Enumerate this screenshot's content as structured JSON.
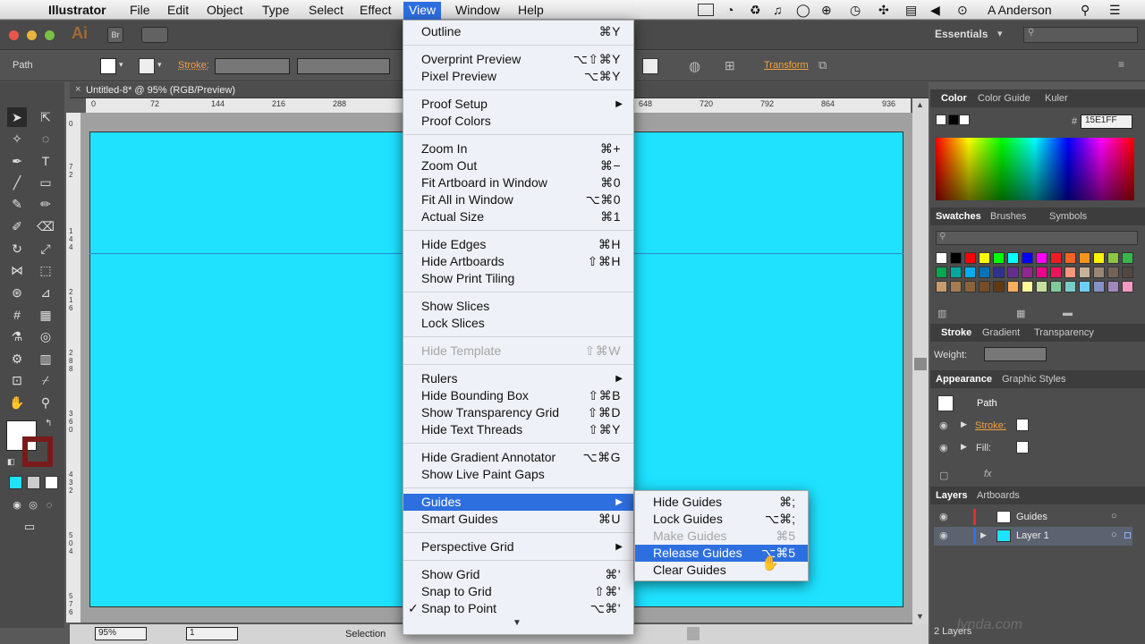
{
  "menubar": {
    "app": "Illustrator",
    "items": [
      "File",
      "Edit",
      "Object",
      "Type",
      "Select",
      "Effect",
      "View",
      "Window",
      "Help"
    ],
    "user": "A Anderson"
  },
  "approw": {
    "logo": "Ai",
    "bridge": "Br",
    "workspace": "Essentials"
  },
  "control": {
    "selection_label": "Path",
    "stroke_label": "Stroke:",
    "transform_label": "Transform"
  },
  "document": {
    "tab_title": "Untitled-8* @ 95% (RGB/Preview)",
    "zoom": "95%",
    "artboard_num": "1",
    "status": "Selection",
    "artboard_color": "#1EE2FF"
  },
  "ruler": {
    "h_ticks": [
      "0",
      "72",
      "144",
      "216",
      "288",
      "648",
      "720",
      "792",
      "864",
      "936"
    ],
    "v_ticks": [
      "0",
      "7\n2",
      "1\n4\n4",
      "2\n1\n6",
      "2\n8\n8",
      "3\n6\n0",
      "4\n3\n2",
      "5\n0\n4",
      "5\n7\n6"
    ]
  },
  "view_menu": {
    "items": [
      {
        "label": "Outline",
        "shortcut": "⌘Y"
      },
      {
        "sep": true
      },
      {
        "label": "Overprint Preview",
        "shortcut": "⌥⇧⌘Y"
      },
      {
        "label": "Pixel Preview",
        "shortcut": "⌥⌘Y"
      },
      {
        "sep": true
      },
      {
        "label": "Proof Setup",
        "submenu": true
      },
      {
        "label": "Proof Colors"
      },
      {
        "sep": true
      },
      {
        "label": "Zoom In",
        "shortcut": "⌘+"
      },
      {
        "label": "Zoom Out",
        "shortcut": "⌘−"
      },
      {
        "label": "Fit Artboard in Window",
        "shortcut": "⌘0"
      },
      {
        "label": "Fit All in Window",
        "shortcut": "⌥⌘0"
      },
      {
        "label": "Actual Size",
        "shortcut": "⌘1"
      },
      {
        "sep": true
      },
      {
        "label": "Hide Edges",
        "shortcut": "⌘H"
      },
      {
        "label": "Hide Artboards",
        "shortcut": "⇧⌘H"
      },
      {
        "label": "Show Print Tiling"
      },
      {
        "sep": true
      },
      {
        "label": "Show Slices"
      },
      {
        "label": "Lock Slices"
      },
      {
        "sep": true
      },
      {
        "label": "Hide Template",
        "shortcut": "⇧⌘W",
        "disabled": true
      },
      {
        "sep": true
      },
      {
        "label": "Rulers",
        "submenu": true
      },
      {
        "label": "Hide Bounding Box",
        "shortcut": "⇧⌘B"
      },
      {
        "label": "Show Transparency Grid",
        "shortcut": "⇧⌘D"
      },
      {
        "label": "Hide Text Threads",
        "shortcut": "⇧⌘Y"
      },
      {
        "sep": true
      },
      {
        "label": "Hide Gradient Annotator",
        "shortcut": "⌥⌘G"
      },
      {
        "label": "Show Live Paint Gaps"
      },
      {
        "sep": true
      },
      {
        "label": "Guides",
        "submenu": true,
        "highlighted": true
      },
      {
        "label": "Smart Guides",
        "shortcut": "⌘U"
      },
      {
        "sep": true
      },
      {
        "label": "Perspective Grid",
        "submenu": true
      },
      {
        "sep": true
      },
      {
        "label": "Show Grid",
        "shortcut": "⌘'"
      },
      {
        "label": "Snap to Grid",
        "shortcut": "⇧⌘'"
      },
      {
        "label": "Snap to Point",
        "shortcut": "⌥⌘'",
        "checked": true
      }
    ]
  },
  "guides_submenu": {
    "items": [
      {
        "label": "Hide Guides",
        "shortcut": "⌘;"
      },
      {
        "label": "Lock Guides",
        "shortcut": "⌥⌘;"
      },
      {
        "label": "Make Guides",
        "shortcut": "⌘5",
        "disabled": true
      },
      {
        "label": "Release Guides",
        "shortcut": "⌥⌘5",
        "highlighted": true
      },
      {
        "label": "Clear Guides"
      }
    ]
  },
  "panels": {
    "color_tabs": [
      "Color",
      "Color Guide",
      "Kuler"
    ],
    "hex_value": "15E1FF",
    "swatch_tabs": [
      "Swatches",
      "Brushes",
      "Symbols"
    ],
    "stroke_tabs": [
      "Stroke",
      "Gradient",
      "Transparency"
    ],
    "weight_label": "Weight:",
    "appearance_tabs": [
      "Appearance",
      "Graphic Styles"
    ],
    "appearance_object": "Path",
    "appearance_stroke": "Stroke:",
    "appearance_fill": "Fill:",
    "layers_tabs": [
      "Layers",
      "Artboards"
    ],
    "layers": [
      {
        "name": "Guides"
      },
      {
        "name": "Layer 1"
      }
    ],
    "layers_count": "2 Layers"
  },
  "colors": {
    "accent": "#2E6FE0",
    "swatches": [
      "#ffffff",
      "#000000",
      "#ff0000",
      "#ffff00",
      "#00ff00",
      "#00ffff",
      "#0000ff",
      "#ff00ff",
      "#ed1c24",
      "#f26522",
      "#f7941d",
      "#fff200",
      "#8dc63f",
      "#39b54a",
      "#00a651",
      "#00a99d",
      "#00aeef",
      "#0072bc",
      "#2e3192",
      "#662d91",
      "#92278f",
      "#ec008c",
      "#ed145b",
      "#f7977a",
      "#c7b299",
      "#998675",
      "#736357",
      "#534741",
      "#c69c6d",
      "#a67c52",
      "#8c6239",
      "#754c24",
      "#603913",
      "#fbaf5d",
      "#fff799",
      "#c4df9b",
      "#82ca9c",
      "#7accc8",
      "#6dcff6",
      "#8393ca",
      "#a187be",
      "#f49ac2"
    ]
  }
}
